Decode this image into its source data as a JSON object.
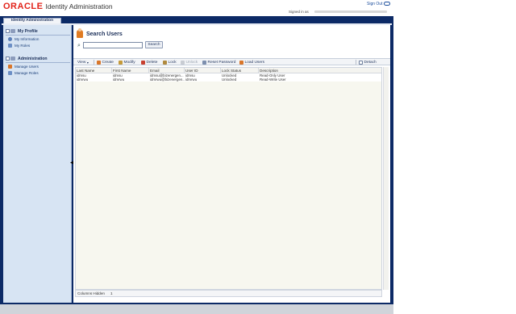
{
  "header": {
    "brand": "ORACLE",
    "app_title": "Identity Administration",
    "sign_out": "Sign Out",
    "signed_in": "Signed in as"
  },
  "tab": {
    "label": "Identity Administration"
  },
  "sidebar": {
    "sections": [
      {
        "title": "My Profile",
        "items": [
          "My Information",
          "My Roles"
        ]
      },
      {
        "title": "Administration",
        "items": [
          "Manage Users",
          "Manage Roles"
        ]
      }
    ]
  },
  "main": {
    "title": "Search Users",
    "search": {
      "value": "",
      "button": "Search"
    },
    "toolbar": {
      "view": "View",
      "create": "Create",
      "modify": "Modify",
      "delete": "Delete",
      "lock": "Lock",
      "unlock": "Unlock",
      "reset_password": "Reset Password",
      "load_users": "Load Users",
      "detach": "Detach"
    },
    "table": {
      "columns": [
        "Last Name",
        "First Name",
        "Email",
        "User ID",
        "Lock Status",
        "Description"
      ],
      "rows": [
        [
          "idmsu",
          "idmsu",
          "idmsu@bizenergen...",
          "idmsu",
          "Unlocked",
          "Read-Only User"
        ],
        [
          "idmrwu",
          "idmrwu",
          "idmrwu@bizenergen...",
          "idmrwu",
          "Unlocked",
          "Read-Write User"
        ]
      ]
    },
    "status": {
      "columns_hidden_label": "Columns Hidden",
      "columns_hidden_value": "1"
    }
  },
  "colors": {
    "oracle_red": "#e2231a",
    "frame_navy": "#0c2a66",
    "sidebar_bg": "#d7e4f3",
    "link_blue": "#1a3f7a"
  }
}
